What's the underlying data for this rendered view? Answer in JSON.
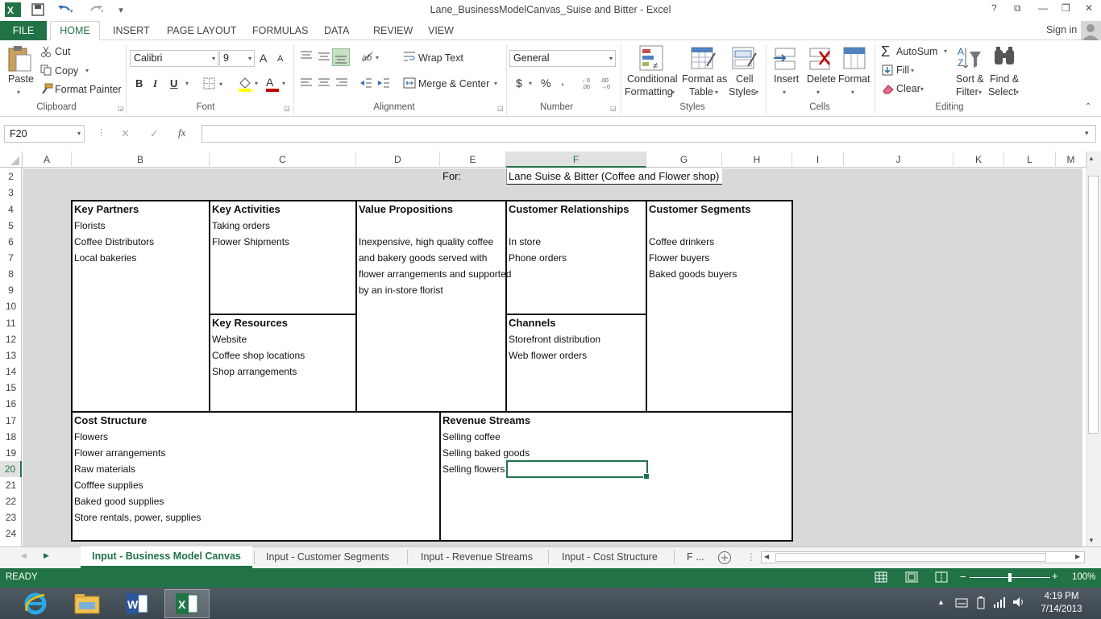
{
  "window": {
    "title": "Lane_BusinessModelCanvas_Suise and Bitter - Excel",
    "help": "?",
    "ribbon_display": "⧉",
    "minimize": "—",
    "restore": "❐",
    "close": "✕"
  },
  "tabs": {
    "file": "FILE",
    "home": "HOME",
    "insert": "INSERT",
    "page_layout": "PAGE LAYOUT",
    "formulas": "FORMULAS",
    "data": "DATA",
    "review": "REVIEW",
    "view": "VIEW",
    "sign_in": "Sign in"
  },
  "ribbon": {
    "clipboard": {
      "paste": "Paste",
      "cut": "Cut",
      "copy": "Copy",
      "format_painter": "Format Painter",
      "group": "Clipboard"
    },
    "font": {
      "name": "Calibri",
      "size": "9",
      "bold": "B",
      "italic": "I",
      "underline": "U",
      "grow": "A",
      "shrink": "A",
      "group": "Font"
    },
    "alignment": {
      "wrap_text": "Wrap Text",
      "merge_center": "Merge & Center",
      "group": "Alignment"
    },
    "number": {
      "format": "General",
      "currency": "$",
      "percent": "%",
      "comma": ",",
      "group": "Number"
    },
    "styles": {
      "conditional": "Conditional",
      "conditional2": "Formatting",
      "format_as": "Format as",
      "format_as2": "Table",
      "cell": "Cell",
      "cell2": "Styles",
      "group": "Styles"
    },
    "cells": {
      "insert": "Insert",
      "delete": "Delete",
      "format": "Format",
      "group": "Cells"
    },
    "editing": {
      "autosum": "AutoSum",
      "fill": "Fill",
      "clear": "Clear",
      "sort": "Sort &",
      "sort2": "Filter",
      "find": "Find &",
      "find2": "Select",
      "group": "Editing"
    }
  },
  "formula_bar": {
    "name_box": "F20",
    "fx": "fx",
    "cancel": "✕",
    "enter": "✓",
    "content": ""
  },
  "columns": [
    "A",
    "B",
    "C",
    "D",
    "E",
    "F",
    "G",
    "H",
    "I",
    "J",
    "K",
    "L",
    "M"
  ],
  "selected_column": "F",
  "rows": [
    "2",
    "3",
    "4",
    "5",
    "6",
    "7",
    "8",
    "9",
    "10",
    "11",
    "12",
    "13",
    "14",
    "15",
    "16",
    "17",
    "18",
    "19",
    "20",
    "21",
    "22",
    "23",
    "24"
  ],
  "selected_row": "20",
  "canvas": {
    "for_label": "For:",
    "for_value": "Lane Suise & Bitter (Coffee and Flower shop)",
    "key_partners": {
      "title": "Key Partners",
      "items": [
        "Florists",
        "Coffee Distributors",
        "Local bakeries"
      ]
    },
    "key_activities": {
      "title": "Key Activities",
      "items": [
        "Taking orders",
        "Flower Shipments"
      ]
    },
    "key_resources": {
      "title": "Key Resources",
      "items": [
        "Website",
        "Coffee shop locations",
        "Shop arrangements"
      ]
    },
    "value_propositions": {
      "title": "Value Propositions",
      "lines": [
        "Inexpensive, high quality coffee",
        "and bakery goods served with",
        "flower arrangements and supported",
        "by an in-store florist"
      ]
    },
    "customer_relationships": {
      "title": "Customer Relationships",
      "items": [
        "In store",
        "Phone orders"
      ]
    },
    "channels": {
      "title": "Channels",
      "items": [
        "Storefront distribution",
        "Web flower orders"
      ]
    },
    "customer_segments": {
      "title": "Customer Segments",
      "items": [
        "Coffee drinkers",
        "Flower buyers",
        "Baked goods buyers"
      ]
    },
    "cost_structure": {
      "title": "Cost Structure",
      "items": [
        "Flowers",
        "Flower arrangements",
        "Raw materials",
        "Cofffee supplies",
        "Baked good supplies",
        "Store rentals, power, supplies"
      ]
    },
    "revenue_streams": {
      "title": "Revenue Streams",
      "items": [
        "Selling coffee",
        "Selling baked goods",
        "Selling flowers"
      ]
    }
  },
  "sheet_tabs": {
    "active": "Input - Business Model Canvas",
    "others": [
      "Input - Customer Segments",
      "Input - Revenue Streams",
      "Input - Cost Structure"
    ],
    "more": "F ..."
  },
  "status": {
    "ready": "READY",
    "zoom": "100%",
    "zoom_level": 1.0
  },
  "taskbar": {
    "time": "4:19 PM",
    "date": "7/14/2013"
  }
}
